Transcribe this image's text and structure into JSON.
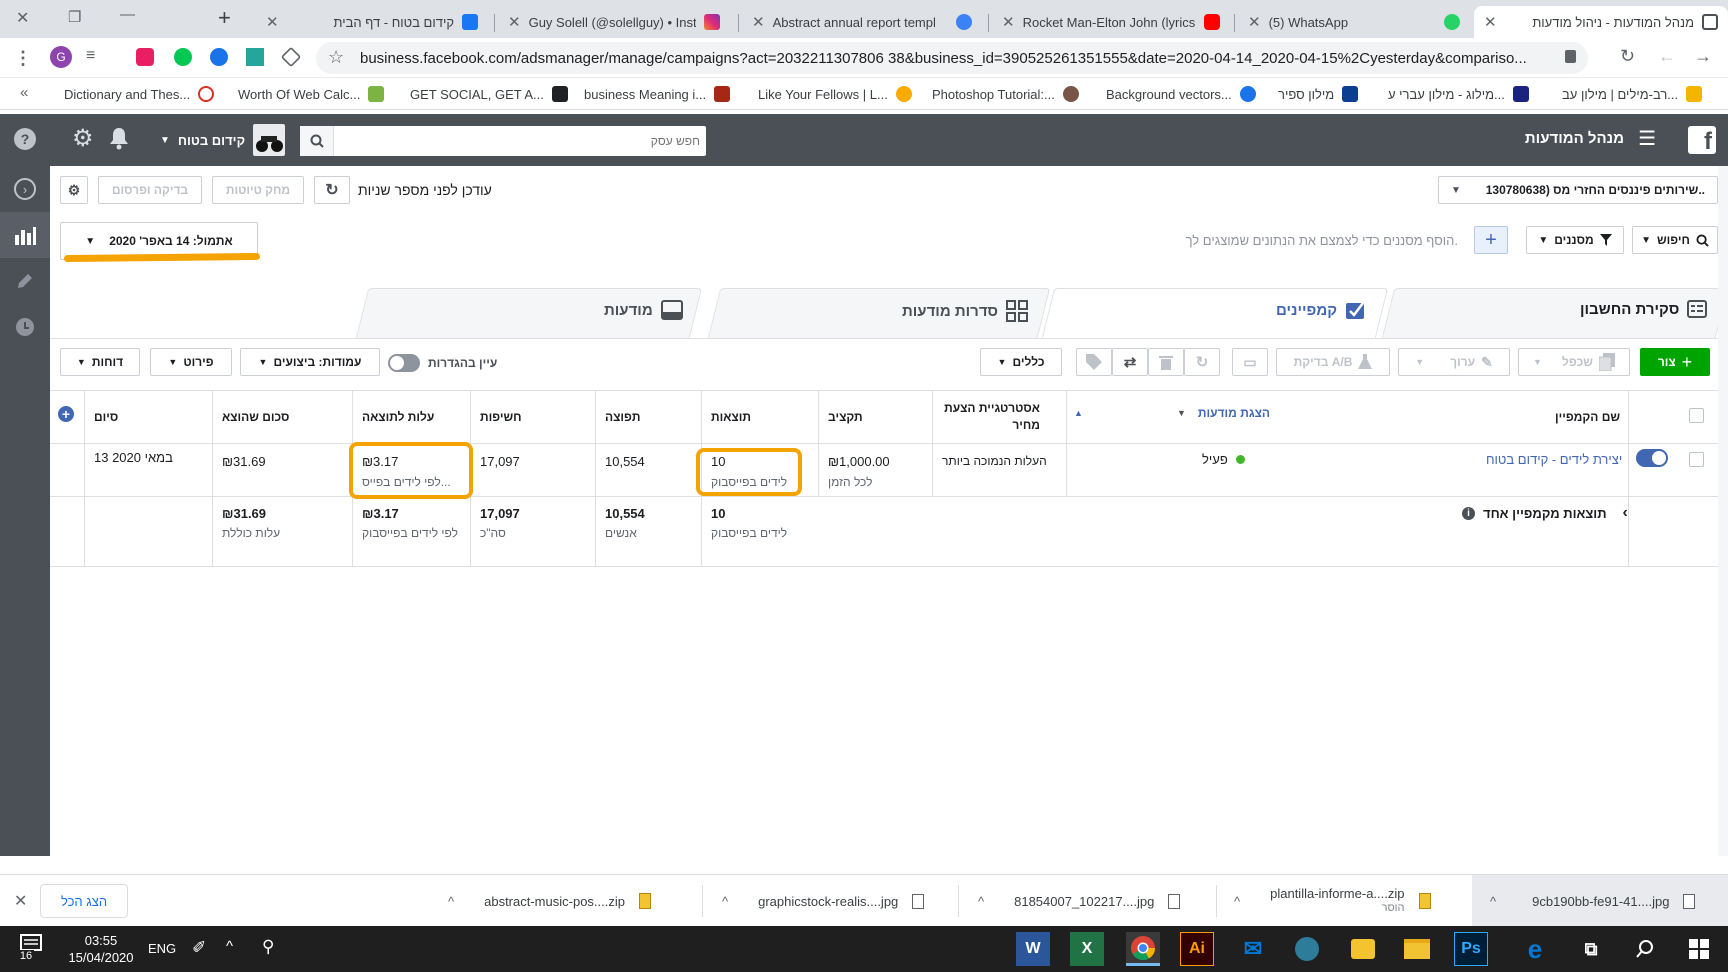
{
  "browser": {
    "tabs": [
      {
        "title": "קידום בטוח - דף הבית",
        "fav_color": "#1877f2"
      },
      {
        "title": "Guy Solell (@solellguy) • Insta",
        "fav_color": "#e1306c"
      },
      {
        "title": "Abstract annual report templ",
        "fav_color": "#3b82f6"
      },
      {
        "title": "Rocket Man-Elton John (lyrics",
        "fav_color": "#ff0000"
      },
      {
        "title": "(5) WhatsApp",
        "fav_color": "#25d366"
      },
      {
        "title": "מנהל המודעות - ניהול מודעות",
        "fav_color": "#4b4f56"
      }
    ],
    "window_controls": {
      "close": "✕",
      "restore": "❐",
      "minimize": "—",
      "new_tab": "+"
    },
    "url": "business.facebook.com/adsmanager/manage/campaigns?act=2032211307806 38&business_id=390525261351555&date=2020-04-14_2020-04-15%2Cyesterday&compariso...",
    "bookmarks": [
      {
        "label": "Dictionary and Thes...",
        "color": "#d93025"
      },
      {
        "label": "Worth Of Web Calc...",
        "color": "#7cb342"
      },
      {
        "label": "GET SOCIAL, GET A...",
        "color": "#202124"
      },
      {
        "label": "business Meaning i...",
        "color": "#a52714"
      },
      {
        "label": "Like Your Fellows | L...",
        "color": "#f9ab00"
      },
      {
        "label": "Photoshop Tutorial:...",
        "color": "#795548"
      },
      {
        "label": "Background vectors...",
        "color": "#1a73e8"
      },
      {
        "label": "מילון ספיר",
        "color": "#0b3d91"
      },
      {
        "label": "מילוג - מילון עברי ע...",
        "color": "#1a237e"
      },
      {
        "label": "רב-מילים | מילון עב...",
        "color": "#f4b400"
      }
    ]
  },
  "fb_header": {
    "title": "מנהל המודעות",
    "search_placeholder": "חפש עסק",
    "account_name": "קידום בטוח"
  },
  "toolbar": {
    "account_select": "שירותים פיננסים החזרי מס (130780638..",
    "updated_text": "עודכן לפני מספר שניות",
    "discard_drafts": "מחק טיוטות",
    "review_publish": "בדיקה ופרסום",
    "date_range": "אתמול: 14 באפר' 2020"
  },
  "filter_bar": {
    "search_label": "חיפוש",
    "filters_label": "מסננים",
    "hint": "הוסף מסננים כדי לצמצם את הנתונים שמוצגים לך."
  },
  "level_tabs": {
    "account_overview": "סקירת החשבון",
    "campaigns": "קמפיינים",
    "ad_sets": "סדרות מודעות",
    "ads": "מודעות"
  },
  "actions": {
    "create": "צור",
    "duplicate": "שכפל",
    "edit": "ערוך",
    "ab_test": "בדיקת A/B",
    "rules": "כללים",
    "view_setup": "עיין בהגדרות",
    "columns": "עמודות: ביצועים",
    "breakdown": "פירוט",
    "reports": "דוחות"
  },
  "table": {
    "headers": {
      "name": "שם הקמפיין",
      "delivery": "הצגת מודעות",
      "bid_strategy": "אסטרטגיית הצעת מחיר",
      "budget": "תקציב",
      "results": "תוצאות",
      "reach": "תפוצה",
      "impressions": "חשיפות",
      "cost_per_result": "עלות לתוצאה",
      "amount_spent": "סכום שהוצא",
      "ends": "סיום"
    },
    "row": {
      "name": "יצירת לידים - קידום בטוח",
      "delivery": "פעיל",
      "bid_strategy": "העלות הנמוכה ביותר",
      "budget": "₪1,000.00",
      "budget_sub": "לכל הזמן",
      "results": "10",
      "results_sub": "לידים בפייסבוק",
      "reach": "10,554",
      "impressions": "17,097",
      "cost_per_result": "₪3.17",
      "cost_per_result_sub": "לפי לידים בפייס...",
      "amount_spent": "₪31.69",
      "ends": "13 במאי 2020"
    },
    "summary": {
      "label": "תוצאות מקמפיין אחד",
      "results": "10",
      "results_sub": "לידים בפייסבוק",
      "reach": "10,554",
      "reach_sub": "אנשים",
      "impressions": "17,097",
      "impressions_sub": "סה\"כ",
      "cost_per_result": "₪3.17",
      "cost_per_result_sub": "לפי לידים בפייסבוק",
      "amount_spent": "₪31.69",
      "amount_spent_sub": "עלות כוללת"
    }
  },
  "downloads": {
    "show_all": "הצג הכל",
    "items": [
      {
        "name": "9cb190bb-fe91-41....jpg",
        "sub": ""
      },
      {
        "name": "plantilla-informe-a....zip",
        "sub": "הוסר"
      },
      {
        "name": "81854007_102217....jpg",
        "sub": ""
      },
      {
        "name": "graphicstock-realis....jpg",
        "sub": ""
      },
      {
        "name": "abstract-music-pos....zip",
        "sub": ""
      }
    ]
  },
  "taskbar": {
    "time": "03:55",
    "date": "15/04/2020",
    "lang": "ENG",
    "notif_count": "16"
  },
  "colors": {
    "fb_header": "#4b4f56",
    "fb_blue": "#4267b2",
    "create_green": "#00a400",
    "highlight": "#f5a300",
    "active_green": "#42b72a"
  }
}
